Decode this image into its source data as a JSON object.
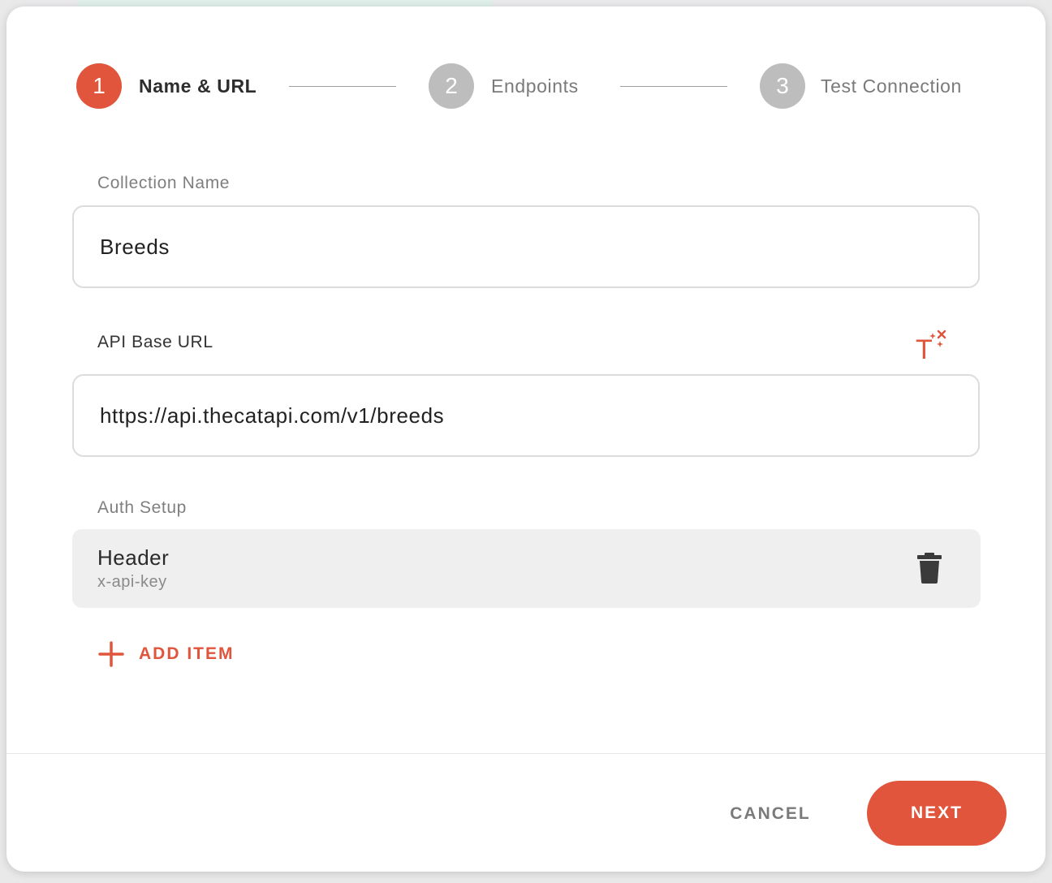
{
  "stepper": {
    "steps": [
      {
        "number": "1",
        "label": "Name & URL",
        "state": "active"
      },
      {
        "number": "2",
        "label": "Endpoints",
        "state": "inactive"
      },
      {
        "number": "3",
        "label": "Test Connection",
        "state": "inactive"
      }
    ]
  },
  "form": {
    "collection_name": {
      "label": "Collection Name",
      "value": "Breeds"
    },
    "api_base_url": {
      "label": "API Base URL",
      "value": "https://api.thecatapi.com/v1/breeds",
      "magic_icon": "magic-text-icon"
    },
    "auth_setup": {
      "label": "Auth Setup",
      "items": [
        {
          "title": "Header",
          "subtitle": "x-api-key",
          "delete_icon": "trash-icon"
        }
      ],
      "add_item_label": "ADD ITEM"
    }
  },
  "footer": {
    "cancel_label": "CANCEL",
    "next_label": "NEXT"
  },
  "colors": {
    "accent": "#e0553b",
    "inactive_step": "#bdbdbd",
    "card_bg": "#efefef"
  }
}
